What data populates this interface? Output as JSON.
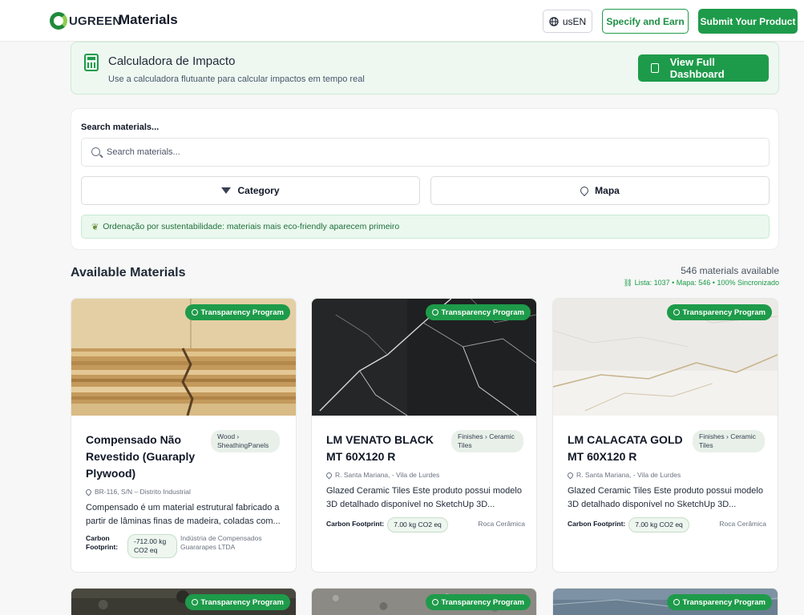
{
  "header": {
    "logo_text": "UGREEN",
    "title": "Materials",
    "language_label": "usEN",
    "specify_label": "Specify and Earn",
    "submit_label": "Submit Your Product"
  },
  "calculator": {
    "title": "Calculadora de Impacto",
    "subtitle": "Use a calculadora flutuante para calcular impactos em tempo real",
    "dashboard_label": "View Full Dashboard"
  },
  "search": {
    "label": "Search materials...",
    "placeholder": "Search materials...",
    "value": "",
    "category_label": "Category",
    "map_label": "Mapa",
    "eco_note": "Ordenação por sustentabilidade: materiais mais eco-friendly aparecem primeiro"
  },
  "available": {
    "title": "Available Materials",
    "count": "546 materials available",
    "sync": "Lista: 1037 • Mapa: 546 • 100% Sincronizado"
  },
  "colors": {
    "brand_green": "#1e9b4a",
    "banner_bg": "#eef8f1"
  },
  "materials": [
    {
      "badge": "Transparency Program",
      "title": "Compensado Não Revestido (Guaraply Plywood)",
      "category": "Wood › SheathingPanels",
      "location": "BR-116, S/N – Distrito Industrial",
      "description": "Compensado é um material estrutural fabricado a partir de lâminas finas de madeira, coladas com...",
      "cf_label": "Carbon Footprint:",
      "cf_value": "-712.00 kg CO2 eq",
      "maker": "Indústria de Compensados Guararapes LTDA",
      "image": "plywood"
    },
    {
      "badge": "Transparency Program",
      "title": "LM VENATO BLACK MT 60X120 R",
      "category": "Finishes › Ceramic Tiles",
      "location": "R. Santa Mariana, - Vila de Lurdes",
      "description": "Glazed Ceramic Tiles Este produto possui modelo 3D detalhado disponível no SketchUp 3D...",
      "cf_label": "Carbon Footprint:",
      "cf_value": "7.00 kg CO2 eq",
      "maker": "Roca Cerâmica",
      "image": "black-marble"
    },
    {
      "badge": "Transparency Program",
      "title": "LM CALACATA GOLD MT 60X120 R",
      "category": "Finishes › Ceramic Tiles",
      "location": "R. Santa Mariana, - Vila de Lurdes",
      "description": "Glazed Ceramic Tiles Este produto possui modelo 3D detalhado disponível no SketchUp 3D...",
      "cf_label": "Carbon Footprint:",
      "cf_value": "7.00 kg CO2 eq",
      "maker": "Roca Cerâmica",
      "image": "white-marble"
    },
    {
      "badge": "Transparency Program",
      "image": "dark-stone"
    },
    {
      "badge": "Transparency Program",
      "image": "grey-terrazzo"
    },
    {
      "badge": "Transparency Program",
      "image": "blue-stone"
    }
  ]
}
